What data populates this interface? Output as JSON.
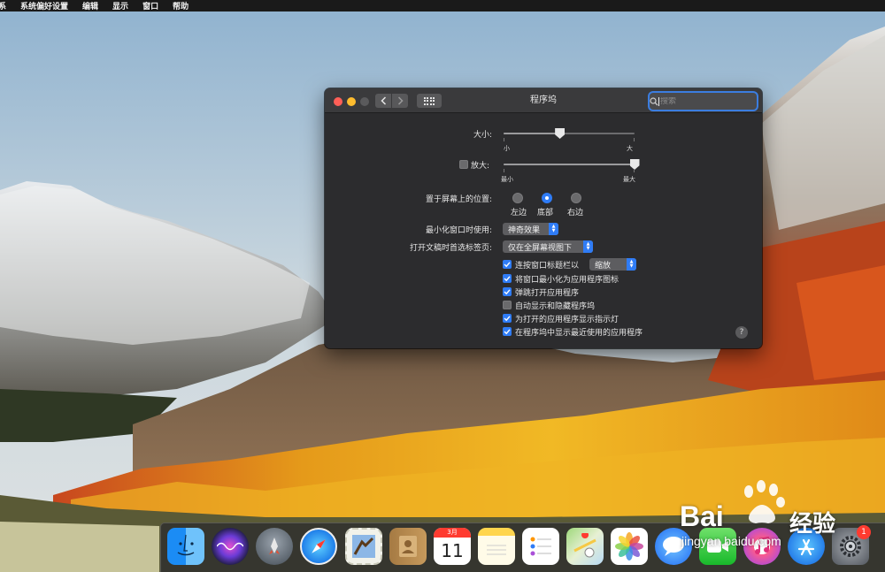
{
  "menubar": {
    "apple_fragment": "系",
    "items": [
      "系统偏好设置",
      "编辑",
      "显示",
      "窗口",
      "帮助"
    ]
  },
  "window": {
    "title": "程序坞",
    "search_placeholder": "搜索"
  },
  "settings": {
    "size": {
      "label": "大小:",
      "min_label": "小",
      "max_label": "大",
      "value": 0.43
    },
    "magnify": {
      "label": "放大:",
      "checked": false,
      "min_label": "最小",
      "max_label": "最大",
      "value": 1.0
    },
    "position": {
      "label": "置于屏幕上的位置:",
      "options": [
        "左边",
        "底部",
        "右边"
      ],
      "selected": "底部"
    },
    "minimize_effect": {
      "label": "最小化窗口时使用:",
      "value": "神奇效果"
    },
    "tabs": {
      "label": "打开文稿时首选标签页:",
      "value": "仅在全屏幕视图下"
    },
    "double_click": {
      "label": "连按窗口标题栏以",
      "checked": true,
      "value": "缩放"
    },
    "checkboxes": [
      {
        "label": "将窗口最小化为应用程序图标",
        "checked": true
      },
      {
        "label": "弹跳打开应用程序",
        "checked": true
      },
      {
        "label": "自动显示和隐藏程序坞",
        "checked": false
      },
      {
        "label": "为打开的应用程序显示指示灯",
        "checked": true
      },
      {
        "label": "在程序坞中显示最近使用的应用程序",
        "checked": true
      }
    ],
    "help": "?"
  },
  "dock": {
    "calendar_month": "3月",
    "calendar_day": "11",
    "badge": "1",
    "apps": [
      "finder",
      "siri",
      "launchpad",
      "safari",
      "mail",
      "contacts",
      "calendar",
      "notes",
      "reminders",
      "maps",
      "photos",
      "messages",
      "facetime",
      "itunes",
      "app-store",
      "system-preferences"
    ]
  },
  "watermark": {
    "brand": "Bai",
    "brand_cn": "经验",
    "url": "jingyan.baidu.com"
  },
  "colors": {
    "accent": "#2f7cf6",
    "window_bg": "#2c2c2e",
    "titlebar_bg": "#3a3a3c"
  }
}
